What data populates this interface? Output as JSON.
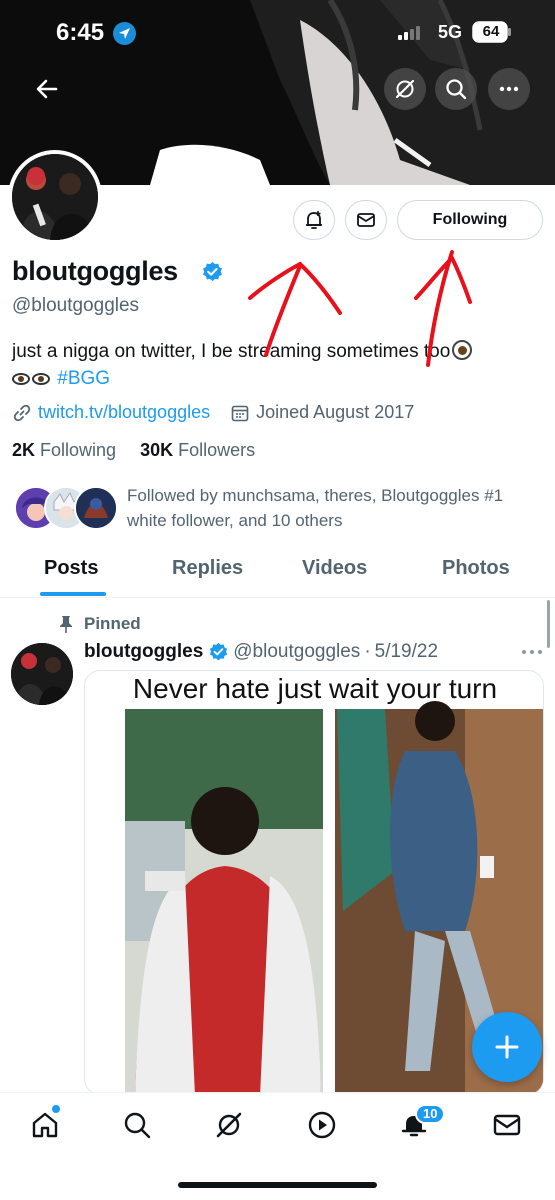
{
  "status_bar": {
    "time": "6:45",
    "network": "5G",
    "battery": "64"
  },
  "header": {
    "back_icon": "arrow-left-icon",
    "actions": [
      "grok-icon",
      "search-icon",
      "more-icon"
    ]
  },
  "profile": {
    "name": "bloutgoggles",
    "handle": "@bloutgoggles",
    "bio_line1": "just a nigga on twitter, I be streaming sometimes too",
    "bio_hashtag": "#BGG",
    "link": "twitch.tv/bloutgoggles",
    "joined": "Joined August 2017",
    "following_count": "2K",
    "following_label": "Following",
    "followers_count": "30K",
    "followers_label": "Followers",
    "followed_by": "Followed by munchsama, theres, Bloutgoggles #1 white follower, and 10 others"
  },
  "buttons": {
    "notify_icon": "bell-plus-icon",
    "message_icon": "envelope-icon",
    "following_label": "Following"
  },
  "tabs": [
    {
      "label": "Posts",
      "active": true
    },
    {
      "label": "Replies",
      "active": false
    },
    {
      "label": "Videos",
      "active": false
    },
    {
      "label": "Photos",
      "active": false
    }
  ],
  "tweet": {
    "pinned_label": "Pinned",
    "author_name": "bloutgoggles",
    "author_handle": "@bloutgoggles",
    "separator": "·",
    "date": "5/19/22",
    "image_caption": "Never hate just wait your turn"
  },
  "bottom_nav": {
    "items": [
      "home-icon",
      "search-icon",
      "grok-icon",
      "play-icon",
      "bell-icon",
      "envelope-icon"
    ],
    "notifications_badge": "10"
  },
  "colors": {
    "accent": "#1d9bf0",
    "annotation": "#e8101a",
    "text": "#0f1419",
    "secondary": "#536471"
  }
}
